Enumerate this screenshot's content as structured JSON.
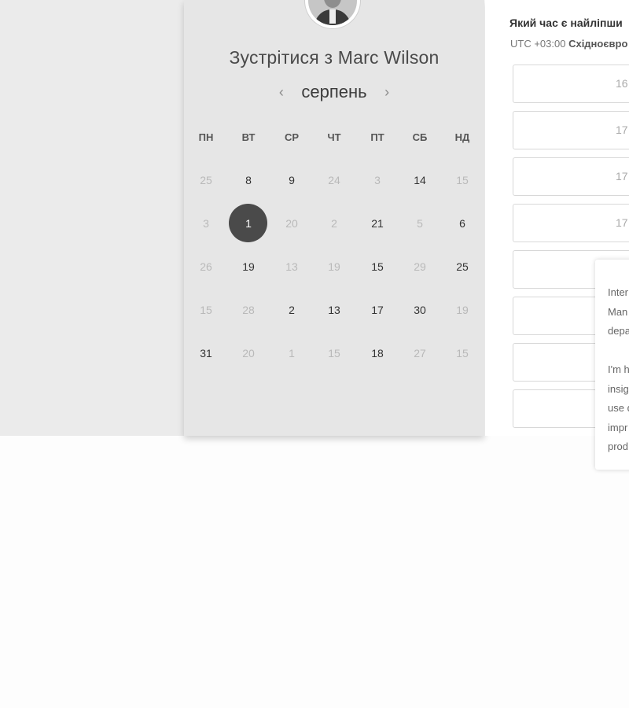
{
  "meeting": {
    "title": "Зустрітися з Marc Wilson",
    "month": "серпень",
    "prev_arrow": "‹",
    "next_arrow": "›"
  },
  "weekdays": [
    "ПН",
    "ВТ",
    "СР",
    "ЧТ",
    "ПТ",
    "СБ",
    "НД"
  ],
  "weeks": [
    [
      {
        "label": "25",
        "available": false
      },
      {
        "label": "8",
        "available": true
      },
      {
        "label": "9",
        "available": true
      },
      {
        "label": "24",
        "available": false
      },
      {
        "label": "3",
        "available": false
      },
      {
        "label": "14",
        "available": true
      },
      {
        "label": "15",
        "available": false
      }
    ],
    [
      {
        "label": "3",
        "available": false
      },
      {
        "label": "1",
        "available": true,
        "selected": true
      },
      {
        "label": "20",
        "available": false
      },
      {
        "label": "2",
        "available": false
      },
      {
        "label": "21",
        "available": true
      },
      {
        "label": "5",
        "available": false
      },
      {
        "label": "6",
        "available": true
      }
    ],
    [
      {
        "label": "26",
        "available": false
      },
      {
        "label": "19",
        "available": true
      },
      {
        "label": "13",
        "available": false
      },
      {
        "label": "19",
        "available": false
      },
      {
        "label": "15",
        "available": true
      },
      {
        "label": "29",
        "available": false
      },
      {
        "label": "25",
        "available": true
      }
    ],
    [
      {
        "label": "15",
        "available": false
      },
      {
        "label": "28",
        "available": false
      },
      {
        "label": "2",
        "available": true
      },
      {
        "label": "13",
        "available": true
      },
      {
        "label": "17",
        "available": true
      },
      {
        "label": "30",
        "available": true
      },
      {
        "label": "19",
        "available": false
      }
    ],
    [
      {
        "label": "31",
        "available": true
      },
      {
        "label": "20",
        "available": false
      },
      {
        "label": "1",
        "available": false
      },
      {
        "label": "15",
        "available": false
      },
      {
        "label": "18",
        "available": true
      },
      {
        "label": "27",
        "available": false
      },
      {
        "label": "15",
        "available": false
      }
    ]
  ],
  "time_panel": {
    "question": "Який час є найліпши",
    "timezone_offset": "UTC +03:00",
    "timezone_name": "Східноєвро",
    "slots": [
      "16",
      "17",
      "17",
      "17",
      "",
      "",
      "",
      ""
    ]
  },
  "tooltip": {
    "lines": [
      "Inter",
      "Man",
      "depa",
      "",
      "I'm h",
      "insig",
      "use d",
      "impr",
      "prod"
    ]
  },
  "icons": {
    "avatar": "profile-photo",
    "prev": "chevron-left-icon",
    "next": "chevron-right-icon"
  }
}
